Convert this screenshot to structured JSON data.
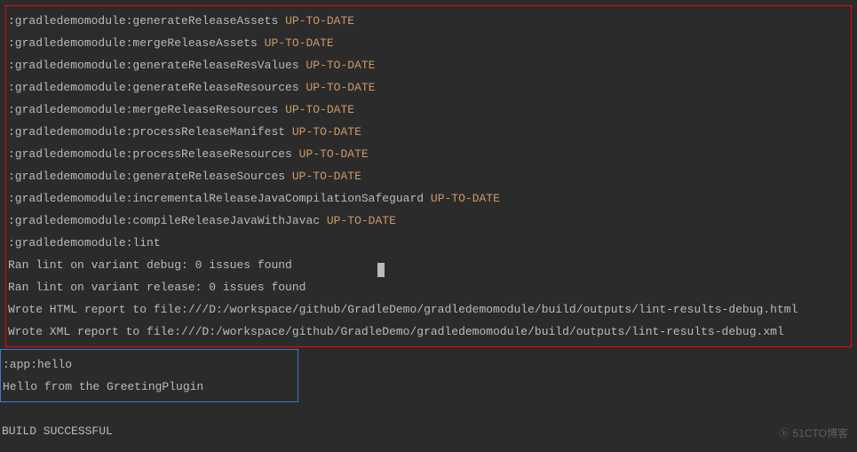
{
  "console": {
    "redBox": [
      {
        "task": ":gradledemomodule:generateReleaseAssets",
        "status": "UP-TO-DATE"
      },
      {
        "task": ":gradledemomodule:mergeReleaseAssets",
        "status": "UP-TO-DATE"
      },
      {
        "task": ":gradledemomodule:generateReleaseResValues",
        "status": "UP-TO-DATE"
      },
      {
        "task": ":gradledemomodule:generateReleaseResources",
        "status": "UP-TO-DATE"
      },
      {
        "task": ":gradledemomodule:mergeReleaseResources",
        "status": "UP-TO-DATE"
      },
      {
        "task": ":gradledemomodule:processReleaseManifest",
        "status": "UP-TO-DATE"
      },
      {
        "task": ":gradledemomodule:processReleaseResources",
        "status": "UP-TO-DATE"
      },
      {
        "task": ":gradledemomodule:generateReleaseSources",
        "status": "UP-TO-DATE"
      },
      {
        "task": ":gradledemomodule:incrementalReleaseJavaCompilationSafeguard",
        "status": "UP-TO-DATE"
      },
      {
        "task": ":gradledemomodule:compileReleaseJavaWithJavac",
        "status": "UP-TO-DATE"
      },
      {
        "task": ":gradledemomodule:lint",
        "status": ""
      }
    ],
    "redBoxPlain": [
      "Ran lint on variant debug: 0 issues found",
      "Ran lint on variant release: 0 issues found",
      "Wrote HTML report to file:///D:/workspace/github/GradleDemo/gradledemomodule/build/outputs/lint-results-debug.html",
      "Wrote XML report to file:///D:/workspace/github/GradleDemo/gradledemomodule/build/outputs/lint-results-debug.xml"
    ],
    "blueBox": [
      ":app:hello",
      "Hello from the GreetingPlugin"
    ],
    "success": "BUILD SUCCESSFUL",
    "watermark": "51CTO博客"
  }
}
